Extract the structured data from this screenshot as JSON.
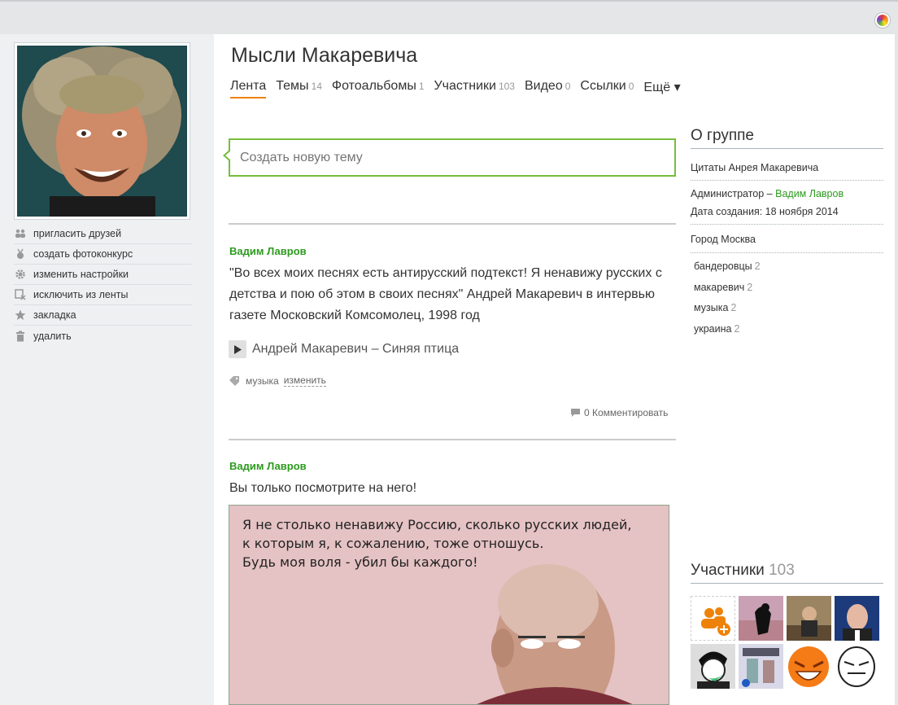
{
  "group": {
    "title": "Мысли Макаревича"
  },
  "actions": [
    {
      "label": "пригласить друзей",
      "icon": "people-icon"
    },
    {
      "label": "создать фотоконкурс",
      "icon": "medal-icon"
    },
    {
      "label": "изменить настройки",
      "icon": "gear-icon"
    },
    {
      "label": "исключить из ленты",
      "icon": "exclude-icon"
    },
    {
      "label": "закладка",
      "icon": "star-icon"
    },
    {
      "label": "удалить",
      "icon": "trash-icon"
    }
  ],
  "tabs": [
    {
      "label": "Лента",
      "count": "",
      "active": true
    },
    {
      "label": "Темы",
      "count": "14"
    },
    {
      "label": "Фотоальбомы",
      "count": "1"
    },
    {
      "label": "Участники",
      "count": "103"
    },
    {
      "label": "Видео",
      "count": "0"
    },
    {
      "label": "Ссылки",
      "count": "0"
    },
    {
      "label": "Ещё ▾",
      "count": ""
    }
  ],
  "compose": {
    "placeholder": "Создать новую тему"
  },
  "posts": [
    {
      "author": "Вадим Лавров",
      "text_lines": [
        "\"Во всех моих песнях есть антирусский подтекст! Я ненавижу русских с",
        "детства и пою об этом в своих песнях\" Андрей Макаревич в интервью",
        "газете Московский Комсомолец, 1998 год"
      ],
      "audio_title": "Андрей Макаревич – Синяя птица",
      "tag": "музыка",
      "change_label": "изменить",
      "comments": "0 Комментировать"
    },
    {
      "author": "Вадим Лавров",
      "text_lines": [
        "Вы только посмотрите на него!"
      ],
      "image_text_lines": [
        "Я не столько ненавижу Россию, сколько русских людей,",
        "к которым я, к сожалению, тоже отношусь.",
        "Будь моя воля - убил бы каждого!"
      ]
    }
  ],
  "about": {
    "heading": "О группе",
    "description": "Цитаты Анрея Макаревича",
    "admin_prefix": "Администратор –",
    "admin_name": "Вадим Лавров",
    "created": "Дата создания: 18 ноября 2014",
    "city": "Город Москва",
    "tags": [
      {
        "label": "бандеровцы",
        "count": "2"
      },
      {
        "label": "макаревич",
        "count": "2"
      },
      {
        "label": "музыка",
        "count": "2"
      },
      {
        "label": "украина",
        "count": "2"
      }
    ]
  },
  "members": {
    "heading": "Участники",
    "count": "103"
  },
  "colors": {
    "accent_green": "#2c9a1e",
    "tab_underline": "#ee8208",
    "compose_border": "#76bd3c"
  }
}
